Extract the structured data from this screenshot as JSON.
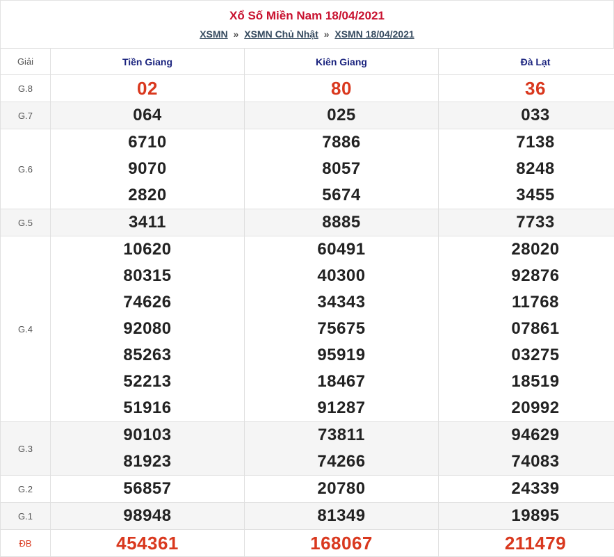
{
  "header": {
    "title": "Xổ Số Miền Nam 18/04/2021",
    "breadcrumb": [
      {
        "label": "XSMN"
      },
      {
        "label": "XSMN Chủ Nhật"
      },
      {
        "label": "XSMN 18/04/2021"
      }
    ],
    "separator": "»"
  },
  "table": {
    "prize_header": "Giải",
    "provinces": [
      "Tiền Giang",
      "Kiên Giang",
      "Đà Lạt"
    ],
    "colors": {
      "accent_red": "#d9381e",
      "title_red": "#c8102e",
      "province_blue": "#1a237e"
    },
    "rows": [
      {
        "prize": "G.8",
        "values": [
          [
            "02"
          ],
          [
            "80"
          ],
          [
            "36"
          ]
        ]
      },
      {
        "prize": "G.7",
        "values": [
          [
            "064"
          ],
          [
            "025"
          ],
          [
            "033"
          ]
        ]
      },
      {
        "prize": "G.6",
        "values": [
          [
            "6710",
            "9070",
            "2820"
          ],
          [
            "7886",
            "8057",
            "5674"
          ],
          [
            "7138",
            "8248",
            "3455"
          ]
        ]
      },
      {
        "prize": "G.5",
        "values": [
          [
            "3411"
          ],
          [
            "8885"
          ],
          [
            "7733"
          ]
        ]
      },
      {
        "prize": "G.4",
        "values": [
          [
            "10620",
            "80315",
            "74626",
            "92080",
            "85263",
            "52213",
            "51916"
          ],
          [
            "60491",
            "40300",
            "34343",
            "75675",
            "95919",
            "18467",
            "91287"
          ],
          [
            "28020",
            "92876",
            "11768",
            "07861",
            "03275",
            "18519",
            "20992"
          ]
        ]
      },
      {
        "prize": "G.3",
        "values": [
          [
            "90103",
            "81923"
          ],
          [
            "73811",
            "74266"
          ],
          [
            "94629",
            "74083"
          ]
        ]
      },
      {
        "prize": "G.2",
        "values": [
          [
            "56857"
          ],
          [
            "20780"
          ],
          [
            "24339"
          ]
        ]
      },
      {
        "prize": "G.1",
        "values": [
          [
            "98948"
          ],
          [
            "81349"
          ],
          [
            "19895"
          ]
        ]
      },
      {
        "prize": "ĐB",
        "values": [
          [
            "454361"
          ],
          [
            "168067"
          ],
          [
            "211479"
          ]
        ]
      }
    ]
  }
}
